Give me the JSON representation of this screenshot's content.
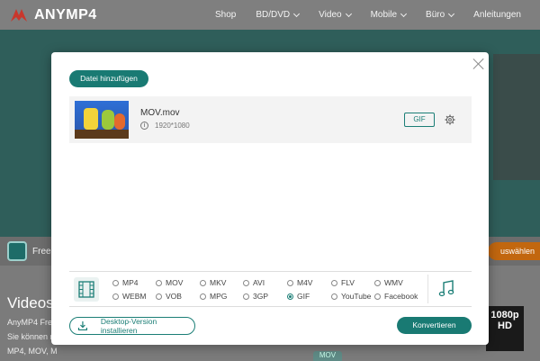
{
  "nav": {
    "logo_text": "ANYMP4",
    "items": [
      "Shop",
      "BD/DVD",
      "Video",
      "Mobile",
      "Büro",
      "Anleitungen"
    ]
  },
  "background": {
    "strip_text": "Free C",
    "strip_button": "uswählen",
    "lower_title": "Videos k",
    "lower_lines": [
      "AnyMP4 Free (",
      "Sie können m",
      "MP4, MOV, M"
    ],
    "badge_text": "1080p HD",
    "mov_tag": "MOV"
  },
  "modal": {
    "add_button": "Datei hinzufügen",
    "file": {
      "name": "MOV.mov",
      "resolution": "1920*1080",
      "format_button": "GIF"
    },
    "formats": [
      {
        "label": "MP4",
        "selected": false
      },
      {
        "label": "MOV",
        "selected": false
      },
      {
        "label": "MKV",
        "selected": false
      },
      {
        "label": "AVI",
        "selected": false
      },
      {
        "label": "M4V",
        "selected": false
      },
      {
        "label": "FLV",
        "selected": false
      },
      {
        "label": "WMV",
        "selected": false
      },
      {
        "label": "WEBM",
        "selected": false
      },
      {
        "label": "VOB",
        "selected": false
      },
      {
        "label": "MPG",
        "selected": false
      },
      {
        "label": "3GP",
        "selected": false
      },
      {
        "label": "GIF",
        "selected": true
      },
      {
        "label": "YouTube",
        "selected": false
      },
      {
        "label": "Facebook",
        "selected": false
      }
    ],
    "desktop_button": "Desktop-Version installieren",
    "convert_button": "Konvertieren"
  },
  "colors": {
    "accent": "#197a73",
    "overlay": "#6e6e6e"
  },
  "icons": [
    "logo-icon",
    "chevron-down-icon",
    "close-icon",
    "info-icon",
    "gear-icon",
    "film-icon",
    "music-icon",
    "download-icon"
  ]
}
